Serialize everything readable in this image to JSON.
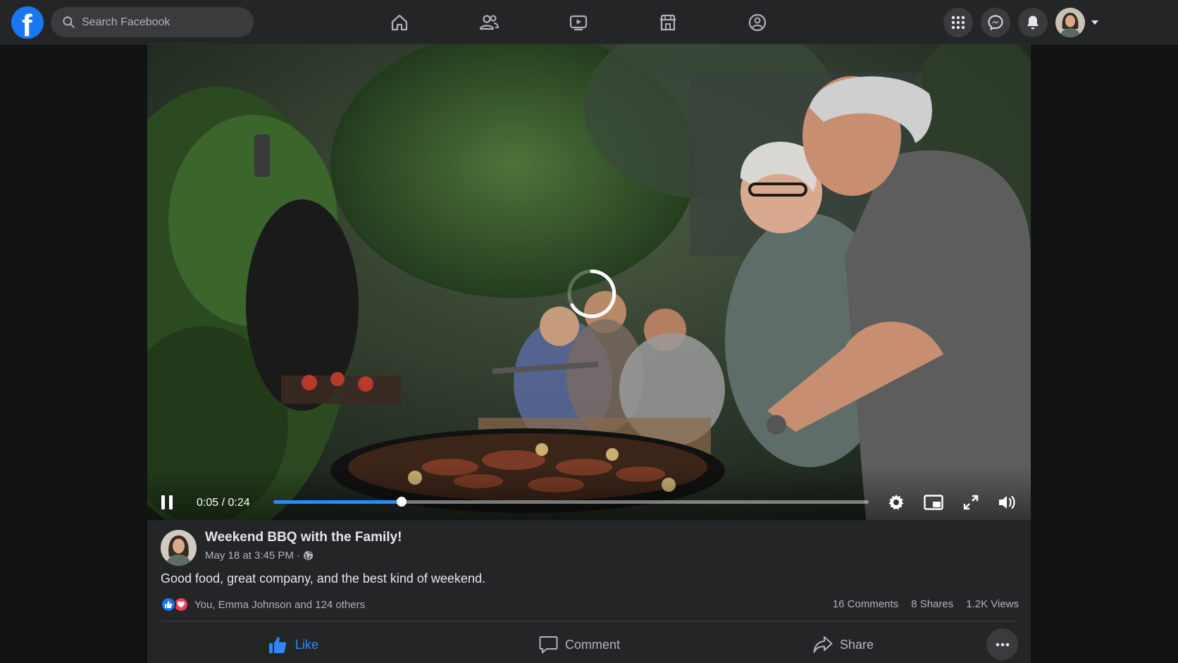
{
  "app": {
    "brand": "facebook",
    "accent": "#1877f2"
  },
  "search": {
    "placeholder": "Search Facebook"
  },
  "nav": {
    "center": [
      {
        "name": "home",
        "icon": "home-icon"
      },
      {
        "name": "friends",
        "icon": "friends-icon"
      },
      {
        "name": "watch",
        "icon": "video-icon"
      },
      {
        "name": "marketplace",
        "icon": "store-icon"
      },
      {
        "name": "groups",
        "icon": "groups-icon"
      }
    ],
    "right": [
      {
        "name": "menu",
        "icon": "grid-menu-icon"
      },
      {
        "name": "messenger",
        "icon": "messenger-icon"
      },
      {
        "name": "notifications",
        "icon": "bell-icon"
      },
      {
        "name": "account",
        "icon": "avatar"
      }
    ]
  },
  "video": {
    "state": "playing",
    "loading": true,
    "current_time": "0:05",
    "duration": "0:24",
    "time_display": "0:05 / 0:24",
    "progress": 0.215,
    "controls": [
      "pause-icon",
      "settings-icon",
      "picture-in-picture-icon",
      "fullscreen-icon",
      "volume-icon"
    ]
  },
  "post": {
    "title": "Weekend BBQ with the Family!",
    "date": "May 18 at 3:45 PM",
    "separator": "·",
    "audience_icon": "globe-icon",
    "text": "Good food, great company, and the best kind of weekend.",
    "reactions": {
      "icons": [
        "like-icon",
        "love-icon"
      ],
      "summary": "You, Emma Johnson and 124 others"
    },
    "stats": {
      "comments": "16 Comments",
      "shares": "8 Shares",
      "views": "1.2K Views"
    },
    "actions": {
      "like": "Like",
      "comment": "Comment",
      "share": "Share"
    }
  }
}
